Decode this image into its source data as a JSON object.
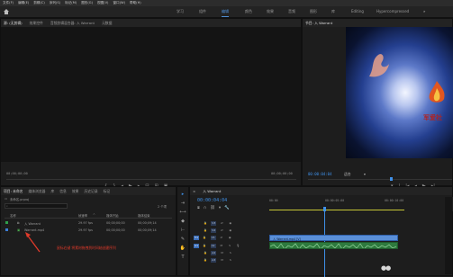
{
  "menu": [
    "文件(F)",
    "编辑(E)",
    "剪辑(C)",
    "序列(S)",
    "标记(M)",
    "图形(G)",
    "视图(V)",
    "窗口(W)",
    "帮助(H)"
  ],
  "workspaces": {
    "items": [
      "学习",
      "组件",
      "编辑",
      "颜色",
      "效果",
      "音频",
      "图形",
      "库",
      "Editing"
    ],
    "active_index": 2,
    "extra": "Hypercompressed"
  },
  "source_panel": {
    "tabs": [
      "源: (无剪辑)",
      "效果控件",
      "音频剪辑混合器: 入 Warrant",
      "元数据"
    ],
    "timecode_left": "00;00;00;00",
    "timecode_right": "00;00;00;00"
  },
  "program_panel": {
    "title": "节目: 入 Warrant",
    "timecode": "00:00:04:04",
    "fit": "适合",
    "logo_text": "军爱社"
  },
  "project_panel": {
    "tabs": [
      "项目: 未命名",
      "媒体浏览器",
      "库",
      "信息",
      "效果",
      "历史记录",
      "标记"
    ],
    "path": "未命名.prproj",
    "count": "2 个项",
    "search_placeholder": "",
    "columns": [
      "名称",
      "帧速率",
      "媒体开始",
      "媒体结束"
    ],
    "rows": [
      {
        "name": "入 Warrant",
        "fps": "29.97 fps",
        "start": "00;00;00;00",
        "end": "00;00;09;14",
        "color": "#2f9e4a"
      },
      {
        "name": "Warrant.mp4",
        "fps": "29.97 fps",
        "start": "00;00;00;00",
        "end": "00;00;09;14",
        "color": "#3c7ed6"
      }
    ]
  },
  "annotation": {
    "text": "鼠标右键  将素材拖拽到时间轴创建序列",
    "color": "#e03a2a"
  },
  "timeline": {
    "tab": "入 Warrant",
    "timecode": "00:00:04:04",
    "ruler": [
      "00:00",
      "00:00:05:00",
      "00:00:10:00"
    ],
    "video_tracks": [
      "V3",
      "V2",
      "V1"
    ],
    "audio_tracks": [
      "A1",
      "A2",
      "A3"
    ],
    "video_clip": "入 Warrant.mp4 [V]"
  }
}
